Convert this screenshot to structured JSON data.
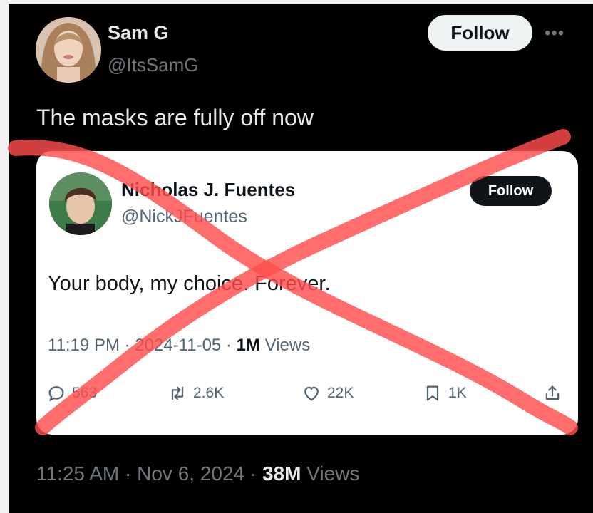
{
  "outer_tweet": {
    "author_name": "Sam G",
    "author_handle": "@ItsSamG",
    "follow_label": "Follow",
    "more_icon": "more-dots-icon",
    "text": "The masks are fully off now",
    "meta": {
      "time": "11:25 AM",
      "sep1": " · ",
      "date": "Nov 6, 2024",
      "sep2": " · ",
      "views_count": "38M",
      "views_label": " Views"
    }
  },
  "quoted_tweet": {
    "author_name": "Nicholas J. Fuentes",
    "author_handle": "@NickJFuentes",
    "follow_label": "Follow",
    "text": "Your body, my choice. Forever.",
    "meta": {
      "time": "11:19 PM",
      "sep1": " · ",
      "date": "2024-11-05",
      "sep2": " · ",
      "views_count": "1M",
      "views_label": " Views"
    },
    "actions": {
      "replies": "563",
      "reposts": "2.6K",
      "likes": "22K",
      "bookmarks": "1K"
    }
  },
  "colors": {
    "background": "#000000",
    "card": "#ffffff",
    "cross_mark": "#ff4d4d",
    "follow_outer_bg": "#eff3f4",
    "follow_inner_bg": "#0f1419"
  }
}
